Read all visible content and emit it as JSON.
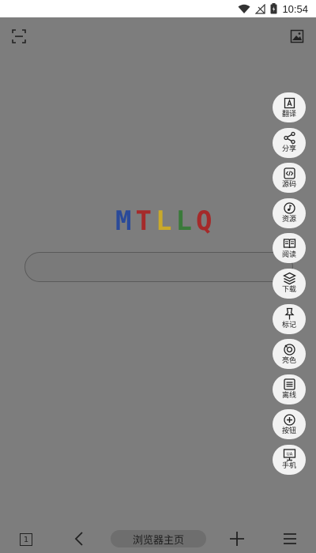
{
  "status_bar": {
    "time": "10:54"
  },
  "logo": {
    "letters": [
      {
        "char": "M",
        "color": "#2a4a9a"
      },
      {
        "char": "T",
        "color": "#a52a2a"
      },
      {
        "char": "L",
        "color": "#c9a92a"
      },
      {
        "char": "L",
        "color": "#3a7a3a"
      },
      {
        "char": "Q",
        "color": "#a52a2a"
      }
    ]
  },
  "tools": [
    {
      "id": "translate",
      "label": "翻译",
      "icon": "translate-icon"
    },
    {
      "id": "share",
      "label": "分享",
      "icon": "share-icon"
    },
    {
      "id": "source",
      "label": "源码",
      "icon": "code-icon"
    },
    {
      "id": "resources",
      "label": "资源",
      "icon": "music-note-icon"
    },
    {
      "id": "read",
      "label": "阅读",
      "icon": "book-icon"
    },
    {
      "id": "download",
      "label": "下载",
      "icon": "layers-icon"
    },
    {
      "id": "bookmark",
      "label": "标记",
      "icon": "pin-icon"
    },
    {
      "id": "brightness",
      "label": "亮色",
      "icon": "eye-icon"
    },
    {
      "id": "offline",
      "label": "离线",
      "icon": "offline-icon"
    },
    {
      "id": "button",
      "label": "按钮",
      "icon": "plus-circle-icon"
    },
    {
      "id": "phone",
      "label": "手机",
      "icon": "monitor-icon"
    }
  ],
  "bottom_nav": {
    "tabs_count": "1",
    "home_label": "浏览器主页"
  }
}
